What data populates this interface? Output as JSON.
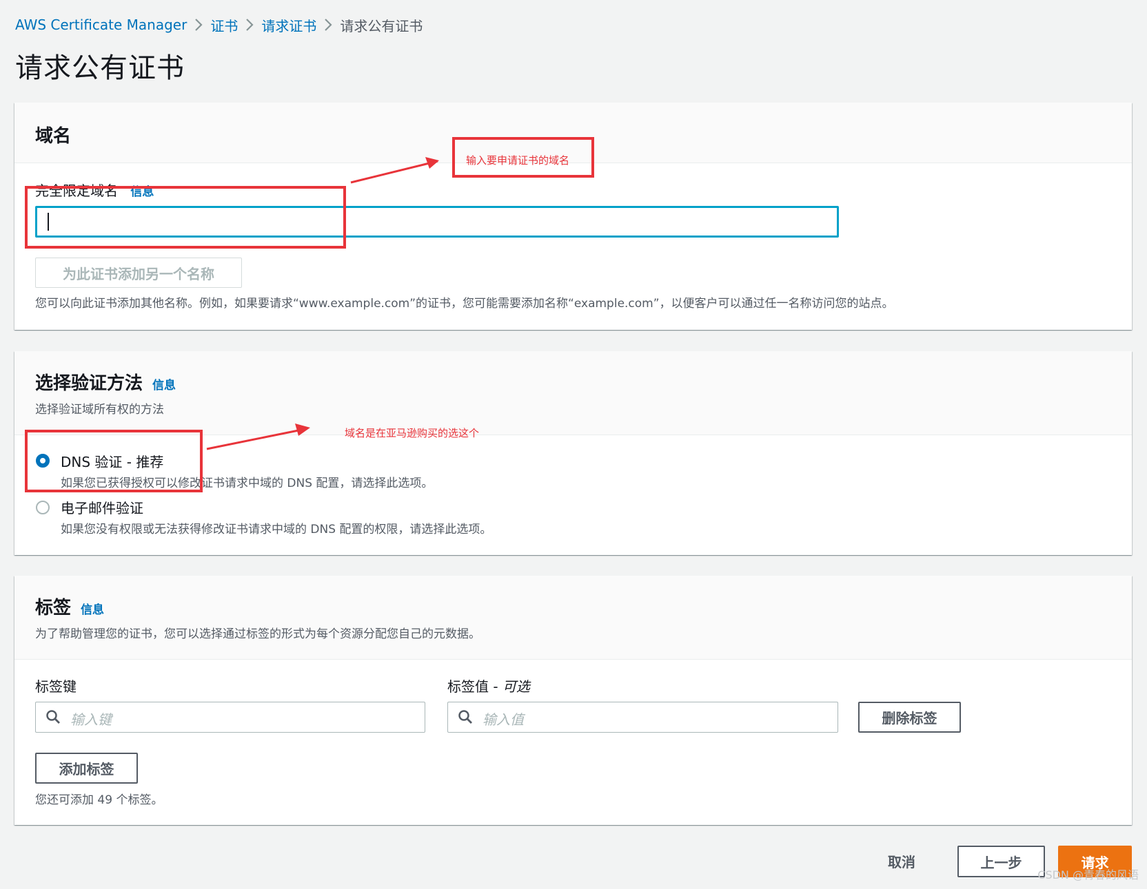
{
  "breadcrumb": {
    "items": [
      "AWS Certificate Manager",
      "证书",
      "请求证书"
    ],
    "current": "请求公有证书"
  },
  "page_title": "请求公有证书",
  "domain_panel": {
    "title": "域名",
    "field_label": "完全限定域名",
    "info": "信息",
    "input_value": "",
    "add_name_button": "为此证书添加另一个名称",
    "hint": "您可以向此证书添加其他名称。例如，如果要请求“www.example.com”的证书，您可能需要添加名称“example.com”，以便客户可以通过任一名称访问您的站点。"
  },
  "validation_panel": {
    "title": "选择验证方法",
    "info": "信息",
    "description": "选择验证域所有权的方法",
    "options": [
      {
        "label": "DNS 验证 - 推荐",
        "description": "如果您已获得授权可以修改证书请求中域的 DNS 配置，请选择此选项。",
        "checked": true
      },
      {
        "label": "电子邮件验证",
        "description": "如果您没有权限或无法获得修改证书请求中域的 DNS 配置的权限，请选择此选项。",
        "checked": false
      }
    ]
  },
  "tags_panel": {
    "title": "标签",
    "info": "信息",
    "description": "为了帮助管理您的证书，您可以选择通过标签的形式为每个资源分配您自己的元数据。",
    "key_label": "标签键",
    "value_label": "标签值 - ",
    "value_label_optional": "可选",
    "key_placeholder": "输入键",
    "value_placeholder": "输入值",
    "remove_button": "删除标签",
    "add_button": "添加标签",
    "remaining": "您还可添加 49 个标签。"
  },
  "footer": {
    "cancel": "取消",
    "previous": "上一步",
    "submit": "请求"
  },
  "annotations": {
    "domain_note": "输入要申请证书的域名",
    "dns_note": "域名是在亚马逊购买的选这个"
  },
  "watermark": "CSDN @青春的风语",
  "colors": {
    "link": "#0073bb",
    "primary": "#ec7211",
    "focus": "#00a1c9",
    "annotation": "#e8343a",
    "background": "#f2f3f3"
  },
  "icons": [
    "chevron-right-icon",
    "search-icon",
    "radio-checked-icon",
    "radio-unchecked-icon",
    "arrow-icon"
  ]
}
